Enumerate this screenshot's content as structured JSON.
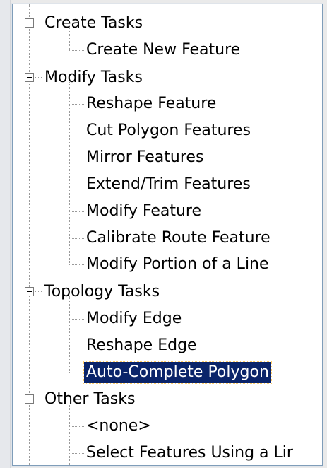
{
  "tree": {
    "groups": [
      {
        "label": "Create Tasks",
        "items": [
          "Create New Feature"
        ]
      },
      {
        "label": "Modify Tasks",
        "items": [
          "Reshape Feature",
          "Cut Polygon Features",
          "Mirror Features",
          "Extend/Trim Features",
          "Modify Feature",
          "Calibrate Route Feature",
          "Modify Portion of a Line"
        ]
      },
      {
        "label": "Topology Tasks",
        "items": [
          "Modify Edge",
          "Reshape Edge",
          "Auto-Complete Polygon"
        ]
      },
      {
        "label": "Other Tasks",
        "items": [
          "<none>",
          "Select Features Using a Lir"
        ]
      }
    ],
    "selected": "Auto-Complete Polygon"
  }
}
